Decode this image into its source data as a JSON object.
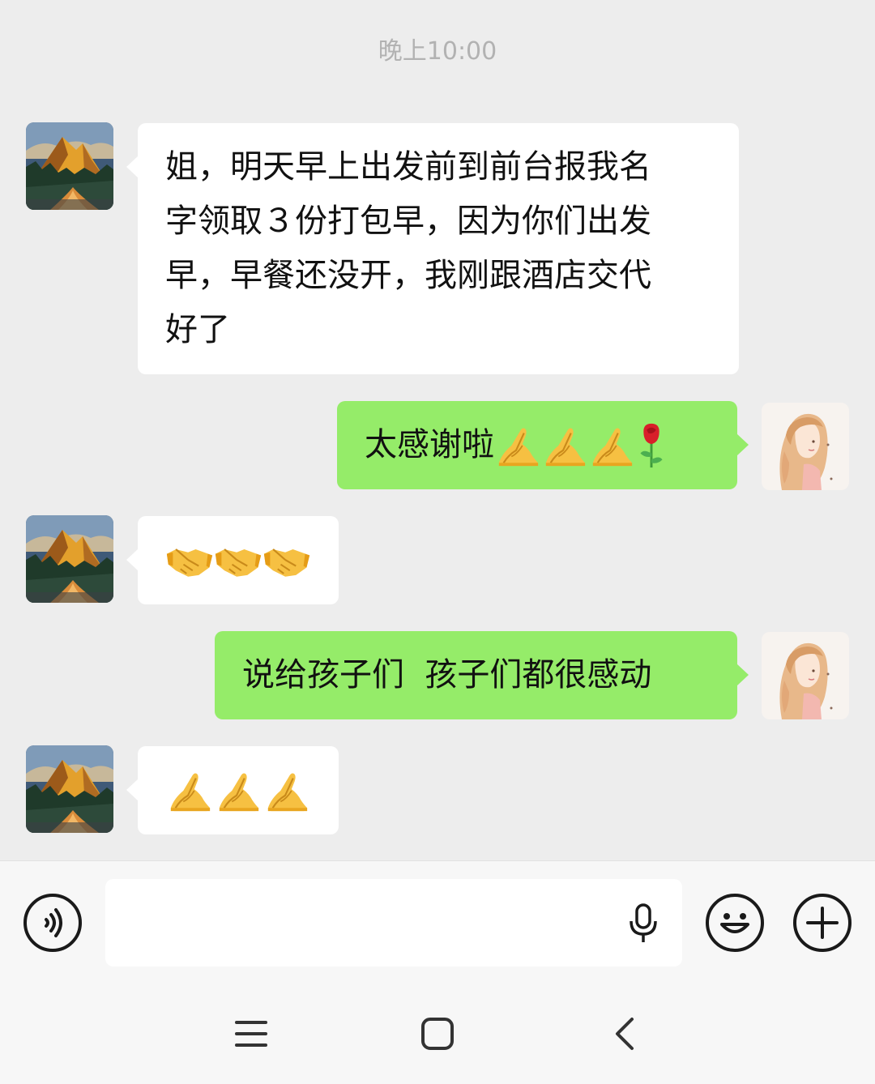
{
  "chat": {
    "timestamp": "晚上10:00",
    "messages": [
      {
        "direction": "in",
        "sender_avatar": "mountain-landscape",
        "text": "姐，明天早上出发前到前台报我名字领取３份打包早，因为你们出发早，早餐还没开，我刚跟酒店交代好了",
        "lines": [
          "姐，明天早上出发前到前台报我名",
          "字领取３份打包早，因为你们出发",
          "早，早餐还没开，我刚跟酒店交代",
          "好了"
        ]
      },
      {
        "direction": "out",
        "sender_avatar": "girl-illustration",
        "text": "太感谢啦",
        "emojis": [
          "pray-emoji",
          "pray-emoji",
          "pray-emoji",
          "rose-emoji"
        ]
      },
      {
        "direction": "in",
        "sender_avatar": "mountain-landscape",
        "emojis": [
          "handshake-emoji",
          "handshake-emoji",
          "handshake-emoji"
        ]
      },
      {
        "direction": "out",
        "sender_avatar": "girl-illustration",
        "text": "说给孩子们  孩子们都很感动"
      },
      {
        "direction": "in",
        "sender_avatar": "mountain-landscape",
        "emojis": [
          "pray-emoji",
          "pray-emoji",
          "pray-emoji"
        ]
      }
    ]
  },
  "input_bar": {
    "voice_icon": "voice-icon",
    "input_value": "",
    "mic_icon": "microphone-icon",
    "emoji_icon": "smiley-icon",
    "more_icon": "plus-icon"
  },
  "nav_bar": {
    "icons": [
      "menu-icon",
      "home-icon",
      "back-icon"
    ]
  },
  "colors": {
    "background": "#ededed",
    "incoming_bubble": "#ffffff",
    "outgoing_bubble": "#95ec69",
    "timestamp_text": "#b2b2b2"
  }
}
